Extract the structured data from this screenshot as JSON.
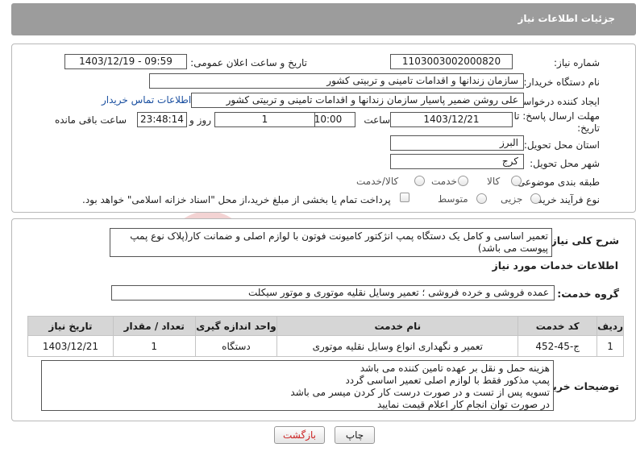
{
  "header": {
    "title": "جزئیات اطلاعات نیاز"
  },
  "fields": {
    "need_number_label": "شماره نیاز:",
    "need_number": "1103003002000820",
    "announce_label": "تاریخ و ساعت اعلان عمومی:",
    "announce_value": "1403/12/19 - 09:59",
    "buyer_org_label": "نام دستگاه خریدار:",
    "buyer_org": "سازمان زندانها و اقدامات تامینی و تربیتی کشور",
    "creator_label": "ایجاد کننده درخواست:",
    "creator": "علی روشن ضمیر پاسیار سازمان زندانها و اقدامات تامینی و تربیتی کشور",
    "buyer_contact_link": "اطلاعات تماس خریدار",
    "deadline_label_1": "مهلت ارسال پاسخ: تا",
    "deadline_label_2": "تاریخ:",
    "deadline_date": "1403/12/21",
    "time_label": "ساعت",
    "deadline_time": "10:00",
    "days_value": "1",
    "days_label": "روز و",
    "remaining_time": "23:48:14",
    "remaining_label": "ساعت باقی مانده",
    "province_label": "استان محل تحویل:",
    "province": "البرز",
    "city_label": "شهر محل تحویل:",
    "city": "کرج",
    "category_label": "طبقه بندی موضوعی:",
    "category_options": [
      "کالا",
      "خدمت",
      "کالا/خدمت"
    ],
    "process_label": "نوع فرآیند خرید :",
    "process_options": [
      "جزیی",
      "متوسط"
    ],
    "payment_note": "پرداخت تمام یا بخشی از مبلغ خرید،از محل \"اسناد خزانه اسلامی\" خواهد بود."
  },
  "summary": {
    "label": "شرح کلی نیاز:",
    "text": "تعمیر اساسی و کامل یک دستگاه پمپ انژکتور کامیونت فوتون با لوازم اصلی و ضمانت کار(پلاک نوع پمپ پیوست می باشد)"
  },
  "services": {
    "section_title": "اطلاعات خدمات مورد نیاز",
    "group_label": "گروه خدمت:",
    "group_value": "عمده فروشی و خرده فروشی ؛ تعمیر وسایل نقلیه موتوری و موتور سیکلت",
    "columns": [
      "ردیف",
      "کد خدمت",
      "نام خدمت",
      "واحد اندازه گیری",
      "تعداد / مقدار",
      "تاریخ نیاز"
    ],
    "rows": [
      [
        "1",
        "ج-45-452",
        "تعمیر و نگهداری انواع وسایل نقلیه موتوری",
        "دستگاه",
        "1",
        "1403/12/21"
      ]
    ]
  },
  "buyer_notes": {
    "label": "توضیحات خریدار:",
    "text": "هزینه حمل و نقل بر عهده تامین کننده می باشد\nپمپ مذکور فقط با لوازم اصلی تعمیر اساسی گردد\nتسویه پس از تست و در صورت درست کار کردن میسر می باشد\nدر صورت توان انجام کار اعلام قیمت نمایید"
  },
  "buttons": {
    "print": "چاپ",
    "back": "بازگشت"
  },
  "watermark": {
    "text": "AriaTender.neT"
  },
  "colors": {
    "header_bg": "#9c9c9c",
    "link": "#1a4fa0",
    "back_text": "#cc2222",
    "watermark": "#f3d3d3"
  }
}
